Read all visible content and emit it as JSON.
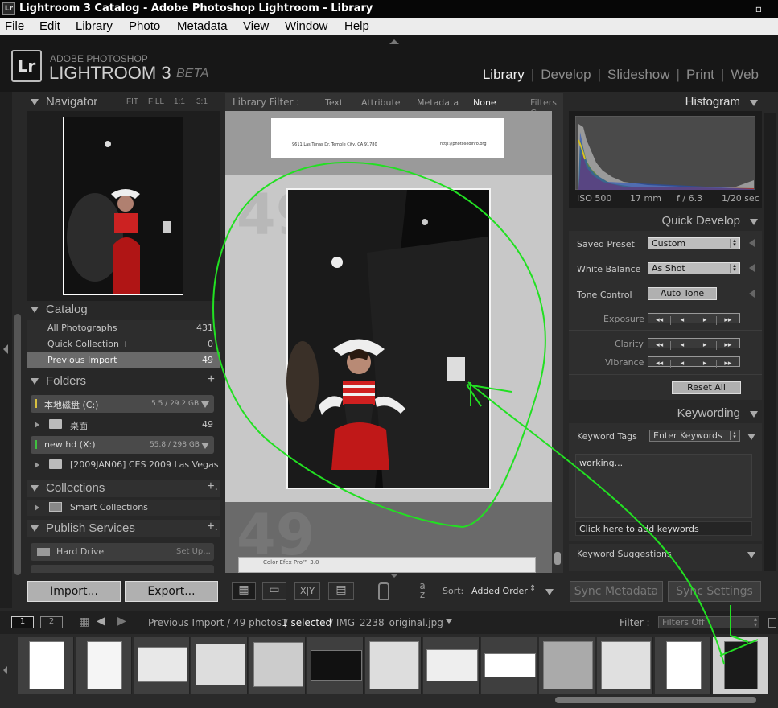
{
  "window": {
    "title": "Lightroom 3 Catalog - Adobe Photoshop Lightroom - Library",
    "app_icon": "Lr"
  },
  "menu": [
    "File",
    "Edit",
    "Library",
    "Photo",
    "Metadata",
    "View",
    "Window",
    "Help"
  ],
  "identity": {
    "brand_small": "ADOBE PHOTOSHOP",
    "brand_main": "LIGHTROOM 3",
    "brand_tag": "BETA",
    "logo": "Lr"
  },
  "modules": [
    "Library",
    "Develop",
    "Slideshow",
    "Print",
    "Web"
  ],
  "navigator": {
    "title": "Navigator",
    "zoom": [
      "FIT",
      "FILL",
      "1:1",
      "3:1"
    ]
  },
  "catalog": {
    "title": "Catalog",
    "items": [
      {
        "label": "All Photographs",
        "count": "431"
      },
      {
        "label": "Quick Collection  +",
        "count": "0"
      },
      {
        "label": "Previous Import",
        "count": "49"
      }
    ]
  },
  "folders": {
    "title": "Folders",
    "add": "+",
    "volumes": [
      {
        "name": "本地磁盘 (C:)",
        "size": "5.5 / 29.2 GB"
      },
      {
        "name": "new hd (X:)",
        "size": "55.8 / 298 GB"
      }
    ],
    "items": [
      {
        "name": "桌面",
        "count": "49"
      },
      {
        "name": "[2009JAN06] CES 2009 Las Vegas",
        "count": ""
      }
    ]
  },
  "collections": {
    "title": "Collections",
    "add": "+.",
    "items": [
      "Smart Collections"
    ]
  },
  "publish": {
    "title": "Publish Services",
    "add": "+.",
    "items": [
      {
        "name": "Hard Drive",
        "action": "Set Up..."
      }
    ]
  },
  "left_buttons": {
    "import": "Import...",
    "export": "Export..."
  },
  "filter_bar": {
    "label": "Library Filter :",
    "options": [
      "Text",
      "Attribute",
      "Metadata",
      "None"
    ],
    "right": "Filters C"
  },
  "grid": {
    "page_address": "9611 Las Tunas Dr. Temple City, CA 91780",
    "page_url": "http://photoseoinfo.org",
    "cell_number": "49",
    "app_caption": "Color Efex Pro™ 3.0"
  },
  "toolbar": {
    "sort_label": "Sort:",
    "sort_value": "Added Order",
    "az": "a\nz"
  },
  "histogram": {
    "title": "Histogram",
    "iso": "ISO 500",
    "focal": "17 mm",
    "aperture": "f / 6.3",
    "shutter": "1/20 sec"
  },
  "quick_develop": {
    "title": "Quick Develop",
    "saved_preset_label": "Saved Preset",
    "saved_preset_value": "Custom",
    "white_balance_label": "White Balance",
    "white_balance_value": "As Shot",
    "tone_control_label": "Tone Control",
    "auto_tone": "Auto Tone",
    "exposure": "Exposure",
    "clarity": "Clarity",
    "vibrance": "Vibrance",
    "reset_all": "Reset All"
  },
  "keywording": {
    "title": "Keywording",
    "tags_label": "Keyword Tags",
    "tags_value": "Enter Keywords",
    "keywords_text": "working...",
    "add_placeholder": "Click here to add keywords",
    "suggestions": "Keyword Suggestions"
  },
  "sync": {
    "metadata": "Sync Metadata",
    "settings": "Sync Settings"
  },
  "filmstrip_bar": {
    "screen1": "1",
    "screen2": "2",
    "source": "Previous Import / 49 photos /",
    "selected": "1 selected",
    "file": "/ IMG_2238_original.jpg",
    "filter_label": "Filter :",
    "filter_value": "Filters Off"
  }
}
